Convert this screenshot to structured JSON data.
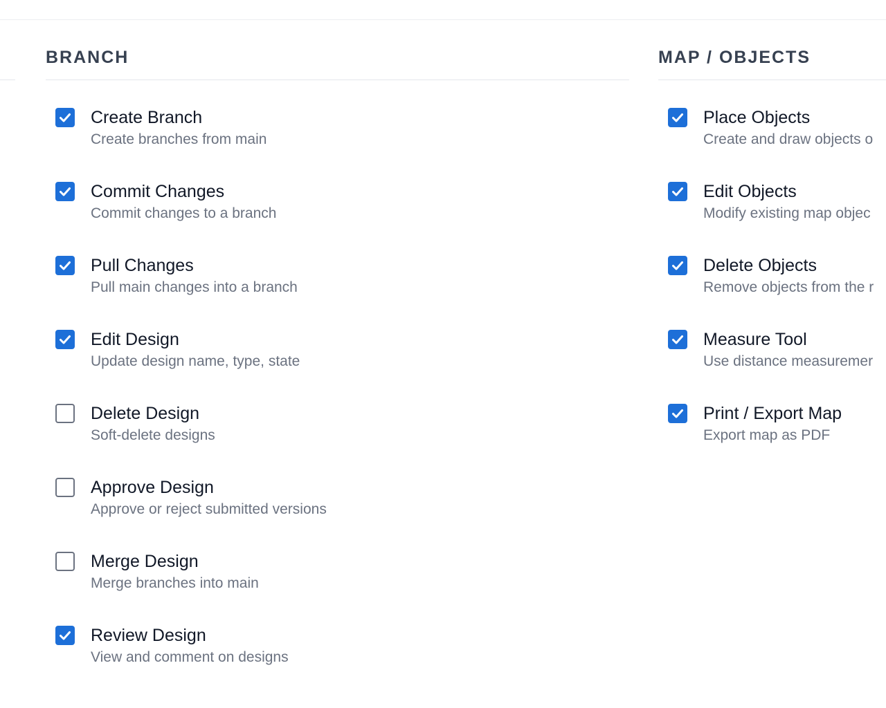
{
  "sections": [
    {
      "title": "BRANCH",
      "items": [
        {
          "label": "Create Branch",
          "description": "Create branches from main",
          "checked": true
        },
        {
          "label": "Commit Changes",
          "description": "Commit changes to a branch",
          "checked": true
        },
        {
          "label": "Pull Changes",
          "description": "Pull main changes into a branch",
          "checked": true
        },
        {
          "label": "Edit Design",
          "description": "Update design name, type, state",
          "checked": true
        },
        {
          "label": "Delete Design",
          "description": "Soft-delete designs",
          "checked": false
        },
        {
          "label": "Approve Design",
          "description": "Approve or reject submitted versions",
          "checked": false
        },
        {
          "label": "Merge Design",
          "description": "Merge branches into main",
          "checked": false
        },
        {
          "label": "Review Design",
          "description": "View and comment on designs",
          "checked": true
        }
      ]
    },
    {
      "title": "MAP / OBJECTS",
      "items": [
        {
          "label": "Place Objects",
          "description": "Create and draw objects o",
          "checked": true
        },
        {
          "label": "Edit Objects",
          "description": "Modify existing map objec",
          "checked": true
        },
        {
          "label": "Delete Objects",
          "description": "Remove objects from the r",
          "checked": true
        },
        {
          "label": "Measure Tool",
          "description": "Use distance measuremer",
          "checked": true
        },
        {
          "label": "Print / Export Map",
          "description": "Export map as PDF",
          "checked": true
        }
      ]
    }
  ],
  "colors": {
    "accent": "#1d6fd8",
    "title": "#374151",
    "label": "#111827",
    "description": "#6b7280",
    "divider": "#e5e7eb"
  }
}
